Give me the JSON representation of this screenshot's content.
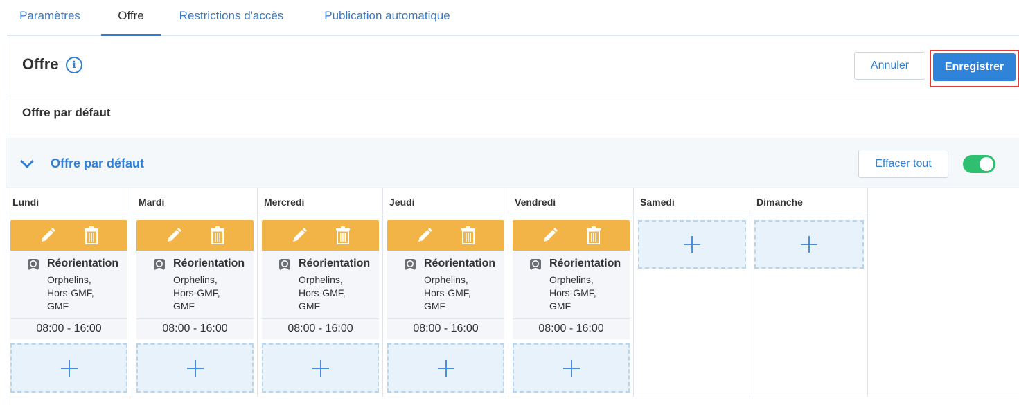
{
  "tabs": [
    {
      "label": "Paramètres"
    },
    {
      "label": "Offre"
    },
    {
      "label": "Restrictions d'accès"
    },
    {
      "label": "Publication automatique"
    }
  ],
  "header": {
    "title": "Offre",
    "info_glyph": "i",
    "cancel_label": "Annuler",
    "save_label": "Enregistrer"
  },
  "section": {
    "label": "Offre par défaut"
  },
  "accordion": {
    "title": "Offre par défaut",
    "clear_label": "Effacer tout",
    "toggle_on": true
  },
  "days": [
    {
      "name": "Lundi"
    },
    {
      "name": "Mardi"
    },
    {
      "name": "Mercredi"
    },
    {
      "name": "Jeudi"
    },
    {
      "name": "Vendredi"
    },
    {
      "name": "Samedi"
    },
    {
      "name": "Dimanche"
    }
  ],
  "slot": {
    "title": "Réorientation",
    "lines": [
      "Orphelins,",
      "Hors-GMF,",
      "GMF"
    ],
    "time": "08:00 - 16:00"
  },
  "colors": {
    "accent": "#2f83d9",
    "slot_bar": "#f2b447",
    "toggle": "#2fbf71",
    "highlight": "#e53935"
  }
}
